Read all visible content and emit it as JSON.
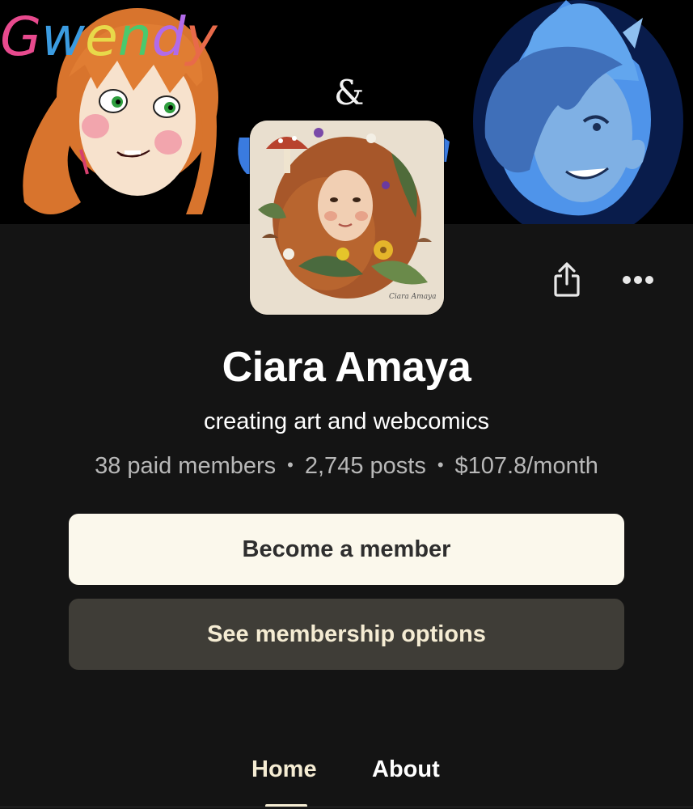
{
  "banner": {
    "title_word": "Gwendy",
    "ampersand": "&",
    "colors": {
      "G": "#e84a8e",
      "w": "#3b9be0",
      "e": "#e8d94a",
      "n": "#4ac96d",
      "d": "#b26be8",
      "y": "#e86a4a"
    }
  },
  "header": {
    "share_icon": "share-icon",
    "more_icon": "more-options-icon"
  },
  "creator": {
    "name": "Ciara Amaya",
    "tagline": "creating art and webcomics",
    "stats": {
      "paid_members": "38 paid members",
      "posts": "2,745 posts",
      "earnings": "$107.8/month",
      "separator": "•"
    }
  },
  "actions": {
    "become_member": "Become a member",
    "see_options": "See membership options"
  },
  "tabs": {
    "home": "Home",
    "about": "About",
    "active": "Home"
  },
  "theme": {
    "background": "#141414",
    "accent_cream": "#f5ecd3",
    "primary_button": "#fbf8ec",
    "secondary_button": "#3f3d37"
  }
}
